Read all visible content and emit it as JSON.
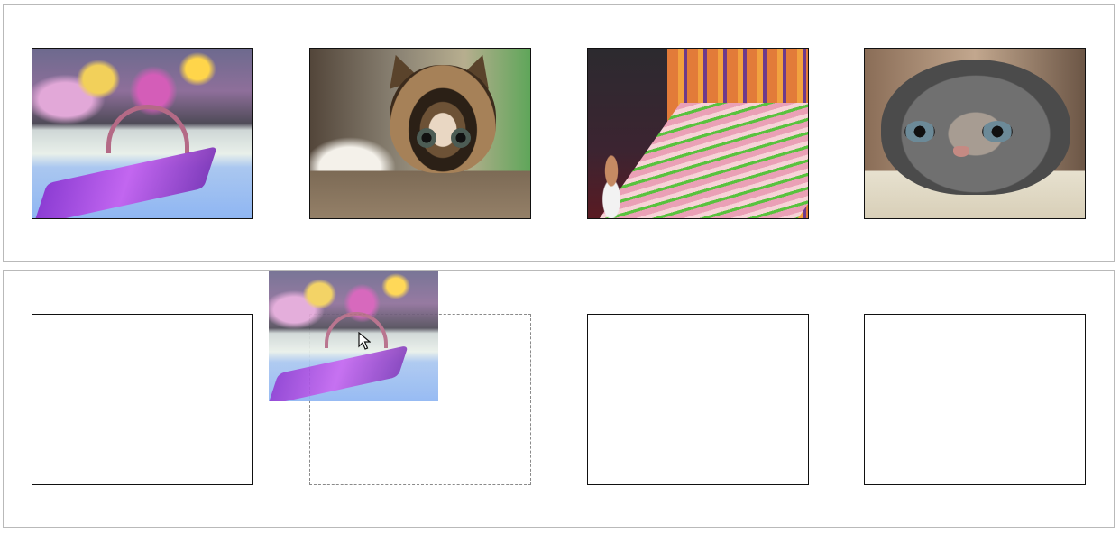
{
  "screen": {
    "source_panel": {
      "items": [
        {
          "name": "fantasy-boat-image",
          "icon": "fantasy-boat-image"
        },
        {
          "name": "kitten-image",
          "icon": "kitten-image"
        },
        {
          "name": "stadium-stairs-image",
          "icon": "stadium-stairs-image"
        },
        {
          "name": "gray-kitten-image",
          "icon": "gray-kitten-image"
        }
      ]
    },
    "target_panel": {
      "slots": [
        {
          "name": "drop-slot-1"
        },
        {
          "name": "drop-slot-2",
          "highlighted": true
        },
        {
          "name": "drop-slot-3"
        },
        {
          "name": "drop-slot-4"
        }
      ]
    },
    "drag": {
      "dragging_item": "fantasy-boat-image",
      "cursor_icon": "arrow-cursor-icon"
    }
  }
}
